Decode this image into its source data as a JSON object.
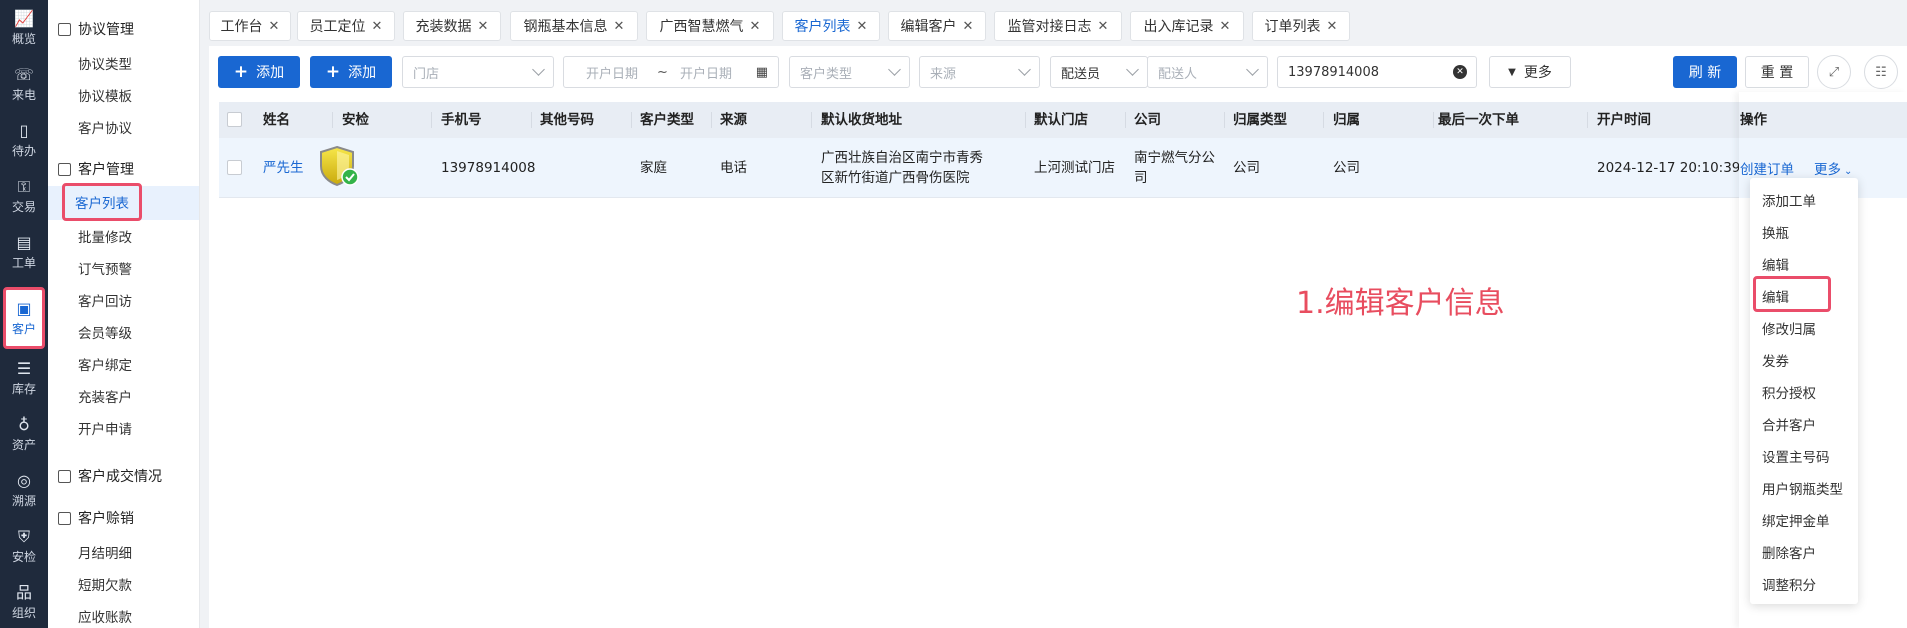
{
  "rail": [
    {
      "icon": "chart-icon",
      "glyph": "📈",
      "label": "概览"
    },
    {
      "icon": "phone-icon",
      "glyph": "☏",
      "label": "来电"
    },
    {
      "icon": "todo-icon",
      "glyph": "▯",
      "label": "待办"
    },
    {
      "icon": "bag-icon",
      "glyph": "👜",
      "label": "交易"
    },
    {
      "icon": "workorder-icon",
      "glyph": "▤",
      "label": "工单"
    },
    {
      "icon": "customer-card-icon",
      "glyph": "▣",
      "label": "客户"
    },
    {
      "icon": "inventory-icon",
      "glyph": "☰",
      "label": "库存"
    },
    {
      "icon": "bulb-icon",
      "glyph": "♁",
      "label": "资产"
    },
    {
      "icon": "compass-icon",
      "glyph": "◎",
      "label": "溯源"
    },
    {
      "icon": "shield-icon",
      "glyph": "⛨",
      "label": "安检"
    },
    {
      "icon": "org-icon",
      "glyph": "品",
      "label": "组织"
    }
  ],
  "menu": {
    "groups": [
      {
        "label": "协议管理",
        "items": [
          "协议类型",
          "协议模板",
          "客户协议"
        ]
      },
      {
        "label": "客户管理",
        "items": [
          "客户列表",
          "批量修改",
          "订气预警",
          "客户回访",
          "会员等级",
          "客户绑定",
          "充装客户",
          "开户申请"
        ]
      },
      {
        "label": "客户成交情况",
        "items": []
      },
      {
        "label": "客户赊销",
        "items": [
          "月结明细",
          "短期欠款",
          "应收账款"
        ]
      }
    ]
  },
  "tabs": [
    "工作台",
    "员工定位",
    "充装数据",
    "钢瓶基本信息",
    "广西智慧燃气",
    "客户列表",
    "编辑客户",
    "监管对接日志",
    "出入库记录",
    "订单列表"
  ],
  "active_tab": "客户列表",
  "toolbar": {
    "add_label_1": "添加",
    "add_label_2": "添加",
    "store_placeholder": "门店",
    "start_date_placeholder": "开户日期",
    "date_sep": "~",
    "end_date_placeholder": "开户日期",
    "customer_type_placeholder": "客户类型",
    "source_placeholder": "来源",
    "dispatcher_select": "配送员",
    "dispatcher_placeholder": "配送人",
    "search_value": "13978914008",
    "more_label": "更多",
    "refresh_label": "刷 新",
    "reset_label": "重 置"
  },
  "table": {
    "headers": [
      "姓名",
      "安检",
      "手机号",
      "其他号码",
      "客户类型",
      "来源",
      "默认收货地址",
      "默认门店",
      "公司",
      "归属类型",
      "归属",
      "最后一次下单",
      "开户时间",
      "操作"
    ],
    "rows": [
      {
        "name": "严先生",
        "phone": "13978914008",
        "other": "",
        "type": "家庭",
        "source": "电话",
        "address_line1": "广西壮族自治区南宁市青秀",
        "address_line2": "区新竹街道广西骨伤医院",
        "store": "上河测试门店",
        "company_line1": "南宁燃气分公",
        "company_line2": "司",
        "owner_type": "公司",
        "owner": "公司",
        "last_order": "",
        "opened": "2024-12-17 20:10:39",
        "action_create": "创建订单",
        "action_more": "更多"
      }
    ]
  },
  "dropdown": [
    "添加工单",
    "换瓶",
    "编辑",
    "编辑",
    "修改归属",
    "发券",
    "积分授权",
    "合并客户",
    "设置主号码",
    "用户钢瓶类型",
    "绑定押金单",
    "删除客户",
    "调整积分"
  ],
  "annotation": "1.编辑客户信息",
  "colors": {
    "primary": "#1967d2",
    "highlight": "#ea4d6a",
    "rail": "#1f2a3c"
  }
}
